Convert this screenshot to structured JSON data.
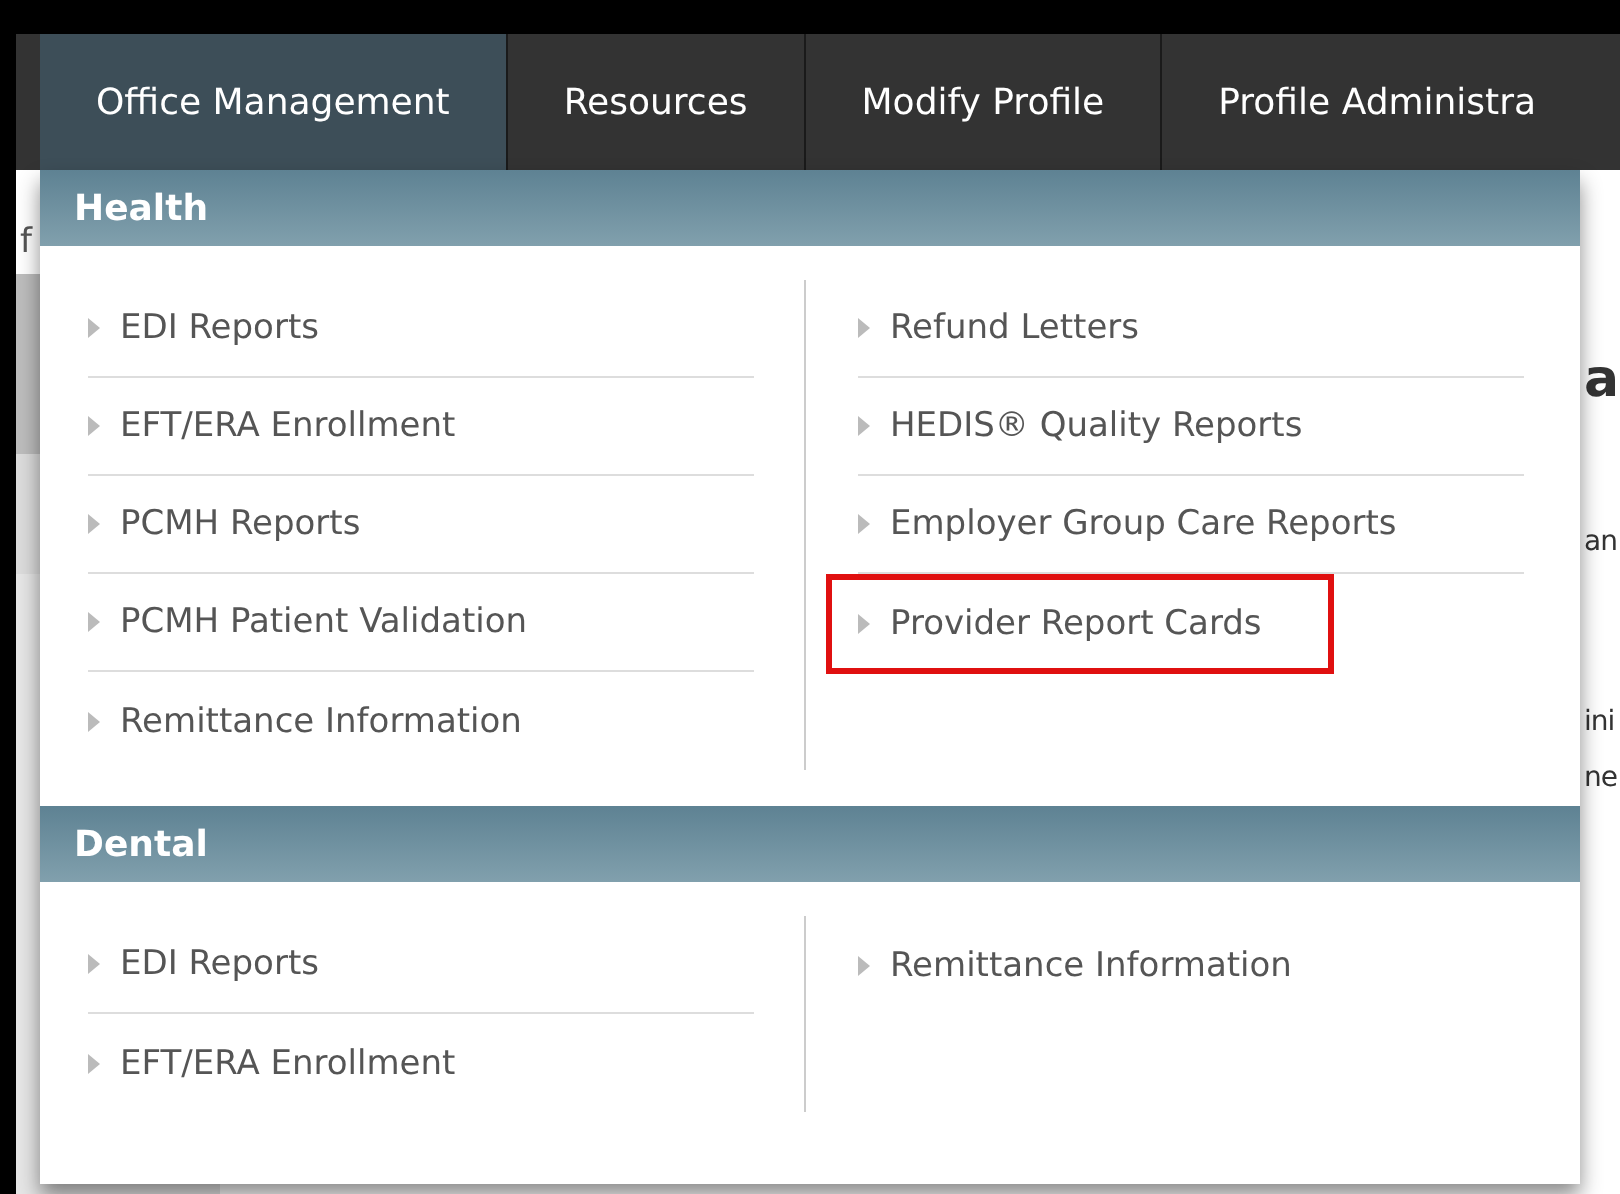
{
  "nav": {
    "tabs": [
      {
        "label": "Office Management",
        "selected": true
      },
      {
        "label": "Resources",
        "selected": false
      },
      {
        "label": "Modify Profile",
        "selected": false
      },
      {
        "label": "Profile Administra",
        "selected": false
      }
    ]
  },
  "background": {
    "left": [
      "f"
    ],
    "right": [
      "a",
      "an",
      "ini",
      "ne"
    ]
  },
  "menu": {
    "sections": [
      {
        "title": "Health",
        "columns": [
          [
            {
              "label": "EDI Reports",
              "highlighted": false
            },
            {
              "label": "EFT/ERA Enrollment",
              "highlighted": false
            },
            {
              "label": "PCMH Reports",
              "highlighted": false
            },
            {
              "label": "PCMH Patient Validation",
              "highlighted": false
            },
            {
              "label": "Remittance Information",
              "highlighted": false
            }
          ],
          [
            {
              "label": "Refund Letters",
              "highlighted": false
            },
            {
              "label": "HEDIS® Quality Reports",
              "highlighted": false
            },
            {
              "label": "Employer Group Care Reports",
              "highlighted": false
            },
            {
              "label": "Provider Report Cards",
              "highlighted": true
            }
          ]
        ]
      },
      {
        "title": "Dental",
        "columns": [
          [
            {
              "label": "EDI Reports",
              "highlighted": false
            },
            {
              "label": "EFT/ERA Enrollment",
              "highlighted": false
            }
          ],
          [
            {
              "label": "Remittance Information",
              "highlighted": false
            }
          ]
        ]
      }
    ]
  }
}
